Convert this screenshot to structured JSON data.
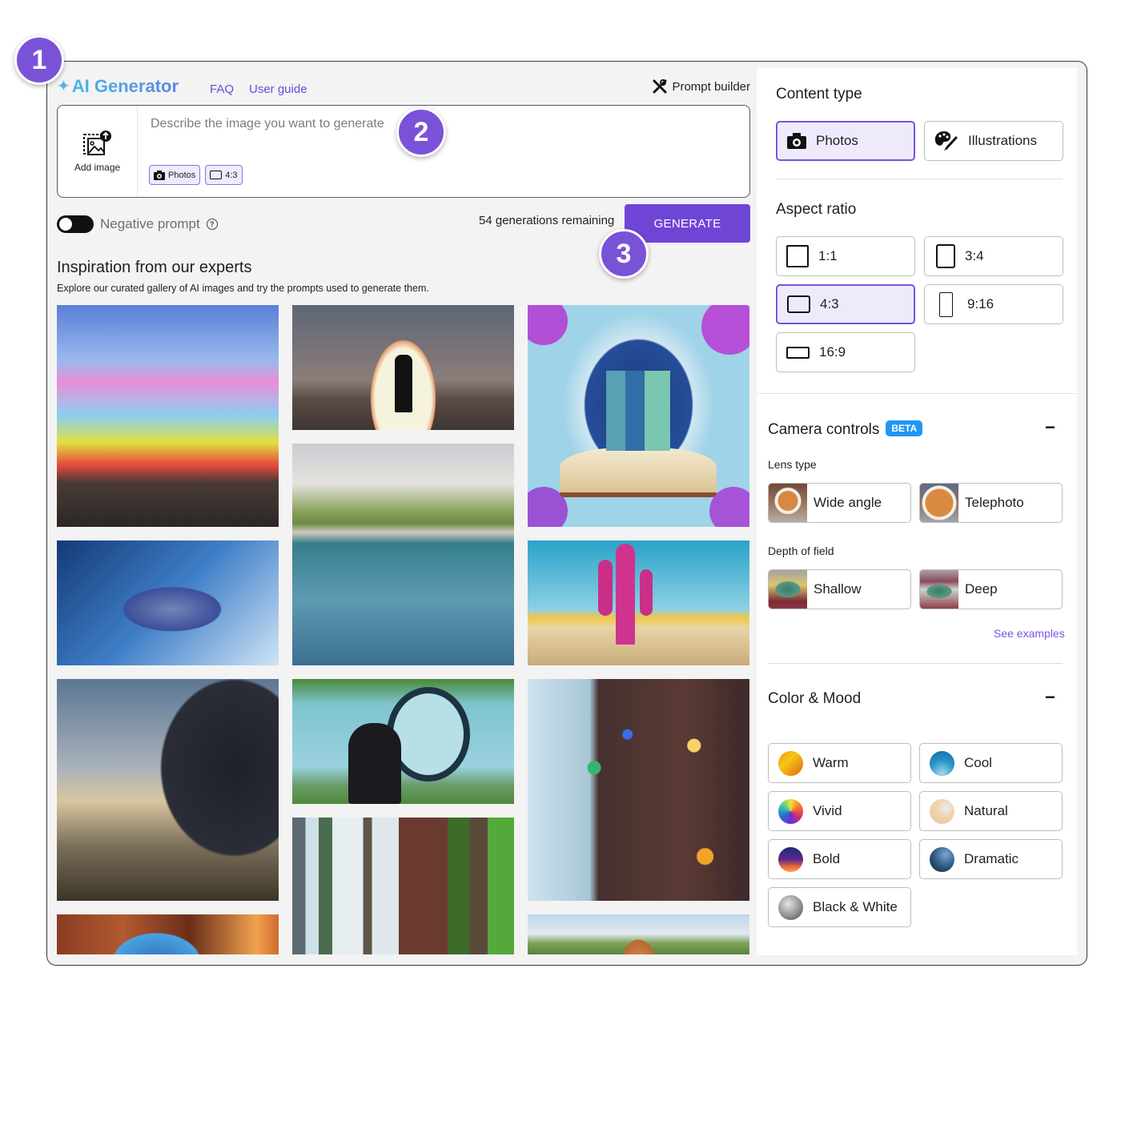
{
  "header": {
    "brand_icon": "sparkle-icon",
    "brand": "AI Generator",
    "links": [
      "FAQ",
      "User guide"
    ],
    "prompt_builder": "Prompt builder",
    "prompt_builder_icon": "tools-icon"
  },
  "prompt": {
    "add_image_label": "Add image",
    "placeholder": "Describe the image you want to generate",
    "value": "",
    "chips": [
      {
        "icon": "camera-icon",
        "label": "Photos"
      },
      {
        "icon": "aspect-ratio-icon",
        "label": "4:3"
      }
    ]
  },
  "controls": {
    "negative_prompt_label": "Negative prompt",
    "negative_prompt_enabled": false,
    "remaining": "54 generations remaining",
    "generate_label": "GENERATE"
  },
  "inspiration": {
    "title": "Inspiration from our experts",
    "subtitle": "Explore our curated gallery of AI images and try the prompts used to generate them.",
    "images": [
      {
        "subject": "rainbow cloud over coastline"
      },
      {
        "subject": "silhouette before glowing arch at sunset"
      },
      {
        "subject": "city and flowers rising from open book"
      },
      {
        "subject": "backyard swimming pool"
      },
      {
        "subject": "sneaker splashing in water"
      },
      {
        "subject": "dolphin swimming in pool"
      },
      {
        "subject": "pink cactus in desert"
      },
      {
        "subject": "horse silhouette at misty dawn"
      },
      {
        "subject": "woman holding mirror with rainbow"
      },
      {
        "subject": "bokeh city lights reflected on wet street"
      },
      {
        "subject": "bookshelf in forest"
      },
      {
        "subject": "camera lens close-up"
      },
      {
        "subject": "corgi in autumn park"
      }
    ]
  },
  "panel": {
    "content_type": {
      "title": "Content type",
      "options": [
        {
          "label": "Photos",
          "icon": "camera-icon",
          "selected": true
        },
        {
          "label": "Illustrations",
          "icon": "palette-icon",
          "selected": false
        }
      ]
    },
    "aspect_ratio": {
      "title": "Aspect ratio",
      "options": [
        {
          "label": "1:1",
          "selected": false
        },
        {
          "label": "3:4",
          "selected": false
        },
        {
          "label": "4:3",
          "selected": true
        },
        {
          "label": "9:16",
          "selected": false
        },
        {
          "label": "16:9",
          "selected": false
        }
      ]
    },
    "camera": {
      "title": "Camera controls",
      "badge": "BETA",
      "lens_label": "Lens type",
      "lens_options": [
        "Wide angle",
        "Telephoto"
      ],
      "dof_label": "Depth of field",
      "dof_options": [
        "Shallow",
        "Deep"
      ],
      "see_examples": "See examples"
    },
    "mood": {
      "title": "Color & Mood",
      "options": [
        "Warm",
        "Cool",
        "Vivid",
        "Natural",
        "Bold",
        "Dramatic",
        "Black & White"
      ]
    }
  },
  "steps": [
    "1",
    "2",
    "3"
  ]
}
